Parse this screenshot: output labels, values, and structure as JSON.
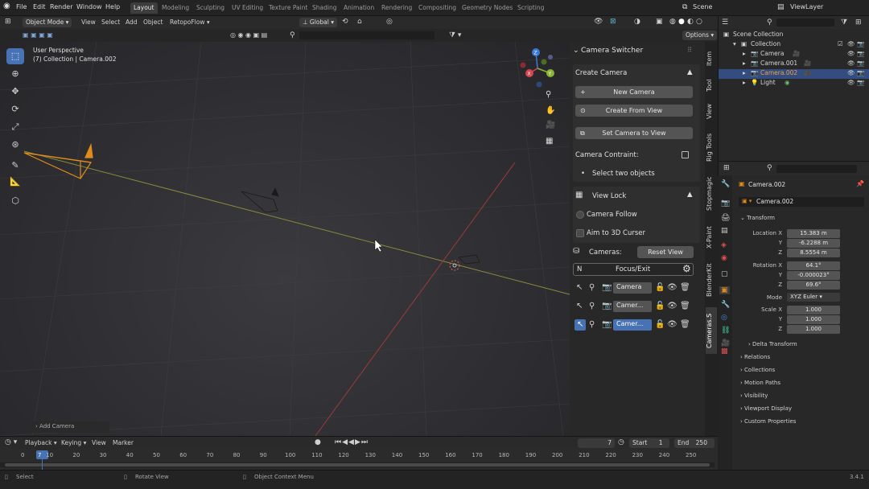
{
  "topbar": {
    "menus": [
      "File",
      "Edit",
      "Render",
      "Window",
      "Help"
    ],
    "workspaces": [
      "Layout",
      "Modeling",
      "Sculpting",
      "UV Editing",
      "Texture Paint",
      "Shading",
      "Animation",
      "Rendering",
      "Compositing",
      "Geometry Nodes",
      "Scripting"
    ],
    "active_workspace": "Layout",
    "scene": "Scene",
    "view_layer": "ViewLayer"
  },
  "viewport_header": {
    "mode": "Object Mode",
    "menus": [
      "View",
      "Select",
      "Add",
      "Object"
    ],
    "addon_menu": "RetopoFlow",
    "transform_orientation": "Global",
    "options": "Options"
  },
  "viewport": {
    "perspective": "User Perspective",
    "collection_info": "(7) Collection | Camera.002",
    "operator_panel": "Add Camera"
  },
  "npanel": {
    "title": "Camera Switcher",
    "create_camera": "Create Camera",
    "new_camera": "New Camera",
    "create_from_view": "Create From View",
    "set_camera_to_view": "Set Camera to View",
    "constraint_label": "Camera Contraint:",
    "select_two": "Select two objects",
    "view_lock": "View Lock",
    "camera_follow": "Camera Follow",
    "aim_3d_cursor": "Aim to 3D Curser",
    "cameras_label": "Cameras:",
    "reset_view": "Reset View",
    "n_key": "N",
    "focus_exit": "Focus/Exit",
    "camera_list": [
      "Camera",
      "Camer...",
      "Camer..."
    ],
    "active_index": 2
  },
  "vertical_tabs": [
    "Item",
    "Tool",
    "View",
    "Rig Tools",
    "Stopmagic",
    "X-Paint",
    "BlenderKit",
    "Cameras.S"
  ],
  "active_vtab": "Cameras.S",
  "outliner": {
    "root": "Scene Collection",
    "collection": "Collection",
    "items": [
      "Camera",
      "Camera.001",
      "Camera.002",
      "Light"
    ],
    "selected": "Camera.002"
  },
  "properties": {
    "object_name": "Camera.002",
    "data_name": "Camera.002",
    "transform": "Transform",
    "location_label": "Location X",
    "location": [
      "15.383 m",
      "-6.2288 m",
      "8.5554 m"
    ],
    "rotation_label": "Rotation X",
    "rotation": [
      "64.1°",
      "-0.000023°",
      "69.6°"
    ],
    "mode_label": "Mode",
    "mode": "XYZ Euler",
    "scale_label": "Scale X",
    "scale": [
      "1.000",
      "1.000",
      "1.000"
    ],
    "axis_y": "Y",
    "axis_z": "Z",
    "delta": "Delta Transform",
    "sections": [
      "Relations",
      "Collections",
      "Motion Paths",
      "Visibility",
      "Viewport Display",
      "Custom Properties"
    ]
  },
  "timeline": {
    "menus": [
      "Playback",
      "Keying",
      "View",
      "Marker"
    ],
    "current_frame": "7",
    "start_label": "Start",
    "start": "1",
    "end_label": "End",
    "end": "250",
    "ticks": [
      "0",
      "10",
      "20",
      "30",
      "40",
      "50",
      "60",
      "70",
      "80",
      "90",
      "100",
      "110",
      "120",
      "130",
      "140",
      "150",
      "160",
      "170",
      "180",
      "190",
      "200",
      "210",
      "220",
      "230",
      "240",
      "250"
    ]
  },
  "status": {
    "select": "Select",
    "rotate": "Rotate View",
    "context": "Object Context Menu",
    "version": "3.4.1"
  }
}
